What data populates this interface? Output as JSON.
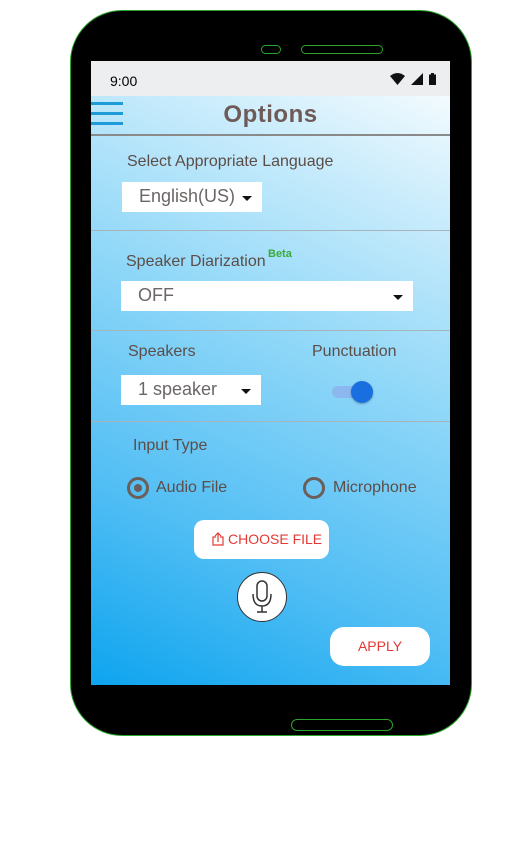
{
  "statusbar": {
    "time": "9:00",
    "icons": [
      "wifi-icon",
      "signal-icon",
      "battery-icon"
    ]
  },
  "header": {
    "title": "Options",
    "menu_icon": "hamburger-menu-icon"
  },
  "language": {
    "label": "Select Appropriate Language",
    "selected": "English(US)"
  },
  "diarization": {
    "label": "Speaker Diarization",
    "badge": "Beta",
    "selected": "OFF"
  },
  "speakers": {
    "label": "Speakers",
    "selected": "1 speaker"
  },
  "punctuation": {
    "label": "Punctuation",
    "enabled": true
  },
  "input_type": {
    "label": "Input Type",
    "options": [
      {
        "label": "Audio File",
        "selected": true
      },
      {
        "label": "Microphone",
        "selected": false
      }
    ]
  },
  "choose_file": {
    "label": "CHOOSE FILE",
    "icon": "upload-icon"
  },
  "mic_button": {
    "icon": "microphone-icon"
  },
  "apply": {
    "label": "APPLY"
  },
  "colors": {
    "accent": "#1a6fe0",
    "button_text": "#e53935",
    "frame": "#000000",
    "outline": "#2aa52a"
  }
}
